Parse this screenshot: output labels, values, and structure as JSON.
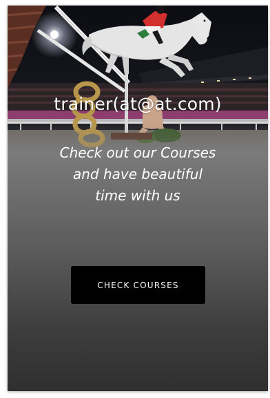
{
  "hero": {
    "email": "trainer(at@at.com)",
    "tagline_line1": "Check out our Courses",
    "tagline_line2": "and have beautiful",
    "tagline_line3": "time with us",
    "cta_label": "CHECK COURSES"
  },
  "colors": {
    "button_bg": "#000000",
    "text": "#ffffff",
    "gradient_top": "#7a7a7a",
    "gradient_bottom": "#2f2f2f"
  }
}
